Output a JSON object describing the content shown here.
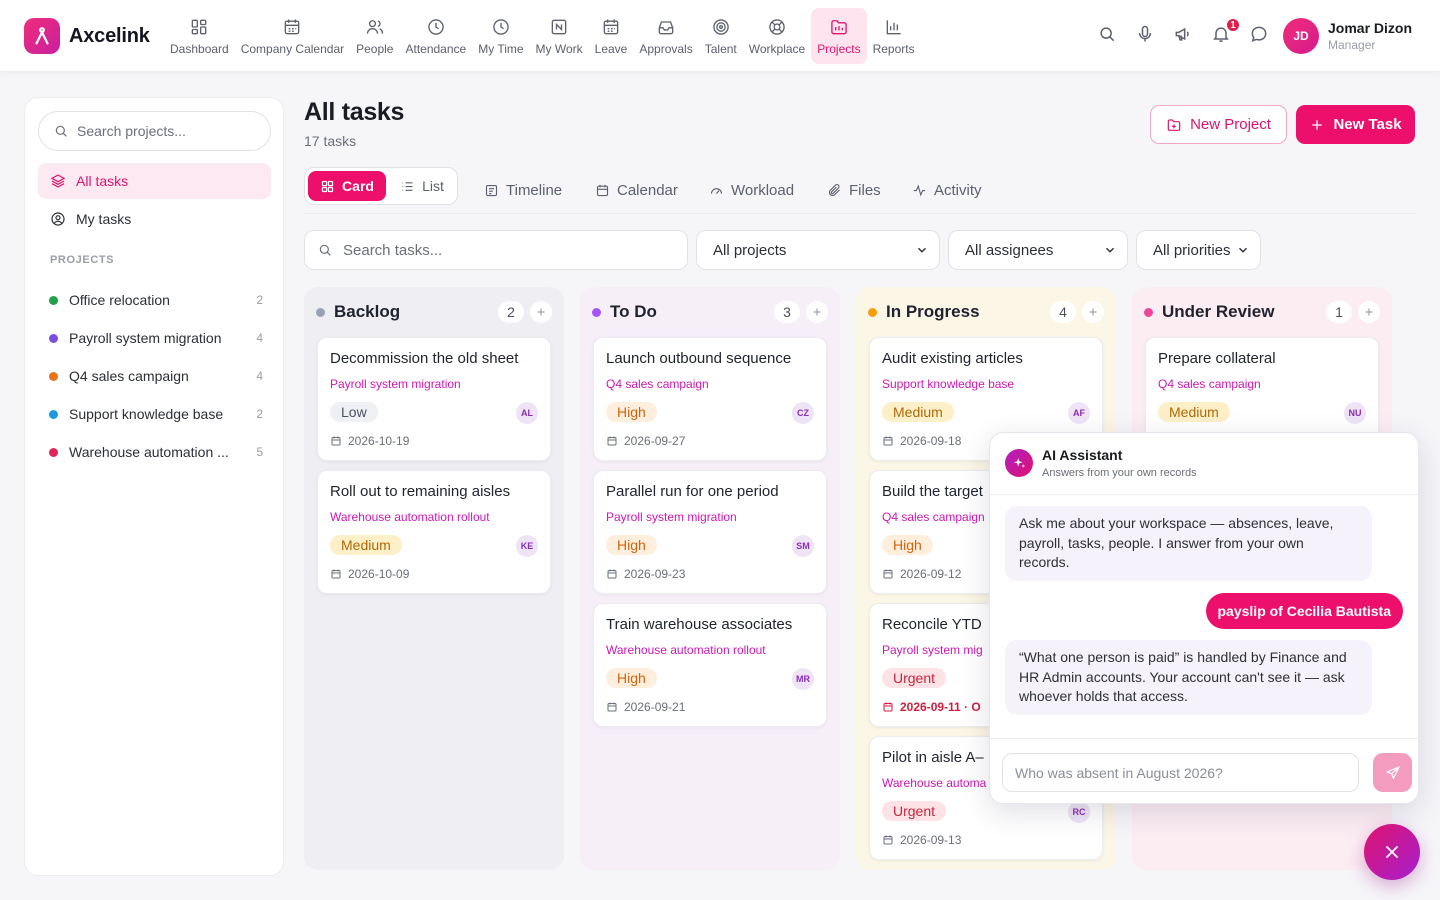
{
  "app": {
    "name": "Axcelink"
  },
  "nav": [
    {
      "label": "Dashboard",
      "icon": "dashboard-icon"
    },
    {
      "label": "Company Calendar",
      "icon": "calendar-icon"
    },
    {
      "label": "People",
      "icon": "people-icon"
    },
    {
      "label": "Attendance",
      "icon": "clock-icon"
    },
    {
      "label": "My Time",
      "icon": "clock-icon"
    },
    {
      "label": "My Work",
      "icon": "folder-icon"
    },
    {
      "label": "Leave",
      "icon": "calendar-icon"
    },
    {
      "label": "Approvals",
      "icon": "inbox-icon"
    },
    {
      "label": "Talent",
      "icon": "target-icon"
    },
    {
      "label": "Workplace",
      "icon": "lifebuoy-icon"
    },
    {
      "label": "Projects",
      "icon": "projects-icon",
      "active": true
    },
    {
      "label": "Reports",
      "icon": "bar-chart-icon"
    }
  ],
  "notifications": {
    "count": "1"
  },
  "user": {
    "initials": "JD",
    "name": "Jomar Dizon",
    "role": "Manager"
  },
  "sidebar": {
    "search_placeholder": "Search projects...",
    "links": [
      {
        "label": "All tasks",
        "active": true
      },
      {
        "label": "My tasks"
      }
    ],
    "projects_heading": "PROJECTS",
    "projects": [
      {
        "name": "Office relocation",
        "count": "2",
        "color": "#22a047"
      },
      {
        "name": "Payroll system migration",
        "count": "4",
        "color": "#7c4ddc"
      },
      {
        "name": "Q4 sales campaign",
        "count": "4",
        "color": "#e8731a"
      },
      {
        "name": "Support knowledge base",
        "count": "2",
        "color": "#1a9be0"
      },
      {
        "name": "Warehouse automation ...",
        "count": "5",
        "color": "#e0245e"
      }
    ]
  },
  "main": {
    "title": "All tasks",
    "subtitle": "17 tasks",
    "new_project": "New Project",
    "new_task": "New Task",
    "view_card": "Card",
    "view_list": "List",
    "tabs": [
      "Timeline",
      "Calendar",
      "Workload",
      "Files",
      "Activity"
    ],
    "search_placeholder": "Search tasks...",
    "filters": {
      "projects": "All projects",
      "assignees": "All assignees",
      "priorities": "All priorities"
    }
  },
  "board": {
    "columns": [
      {
        "title": "Backlog",
        "count": "2",
        "color": "#9aa3b5",
        "bg": "#eeeef3",
        "cards": [
          {
            "title": "Decommission the old sheet",
            "project": "Payroll system migration",
            "priority": "Low",
            "level": "low",
            "assignee": "AL",
            "date": "2026-10-19"
          },
          {
            "title": "Roll out to remaining aisles",
            "project": "Warehouse automation rollout",
            "priority": "Medium",
            "level": "medium",
            "assignee": "KE",
            "date": "2026-10-09"
          }
        ]
      },
      {
        "title": "To Do",
        "count": "3",
        "color": "#a855f7",
        "bg": "#f7eff8",
        "cards": [
          {
            "title": "Launch outbound sequence",
            "project": "Q4 sales campaign",
            "priority": "High",
            "level": "high",
            "assignee": "CZ",
            "date": "2026-09-27"
          },
          {
            "title": "Parallel run for one period",
            "project": "Payroll system migration",
            "priority": "High",
            "level": "high",
            "assignee": "SM",
            "date": "2026-09-23"
          },
          {
            "title": "Train warehouse associates",
            "project": "Warehouse automation rollout",
            "priority": "High",
            "level": "high",
            "assignee": "MR",
            "date": "2026-09-21"
          }
        ]
      },
      {
        "title": "In Progress",
        "count": "4",
        "color": "#f59e0b",
        "bg": "#fcf6e6",
        "cards": [
          {
            "title": "Audit existing articles",
            "project": "Support knowledge base",
            "priority": "Medium",
            "level": "medium",
            "assignee": "AF",
            "date": "2026-09-18"
          },
          {
            "title": "Build the target",
            "project": "Q4 sales campaign",
            "priority": "High",
            "level": "high",
            "assignee": "",
            "date": "2026-09-12"
          },
          {
            "title": "Reconcile YTD",
            "project": "Payroll system mig",
            "priority": "Urgent",
            "level": "urgent",
            "assignee": "",
            "date": "2026-09-11 · O",
            "overdue": true
          },
          {
            "title": "Pilot in aisle A–",
            "project": "Warehouse automa",
            "priority": "Urgent",
            "level": "urgent",
            "assignee": "RC",
            "date": "2026-09-13"
          }
        ]
      },
      {
        "title": "Under Review",
        "count": "1",
        "color": "#ec4899",
        "bg": "#fcedf3",
        "cards": [
          {
            "title": "Prepare collateral",
            "project": "Q4 sales campaign",
            "priority": "Medium",
            "level": "medium",
            "assignee": "NU",
            "date": ""
          }
        ]
      }
    ]
  },
  "assistant": {
    "title": "AI Assistant",
    "subtitle": "Answers from your own records",
    "greeting": "Ask me about your workspace — absences, leave, payroll, tasks, people. I answer from your own records.",
    "user_message": "payslip of Cecilia Bautista",
    "reply": "“What one person is paid” is handled by Finance and HR Admin accounts. Your account can't see it — ask whoever holds that access.",
    "input_placeholder": "Who was absent in August 2026?"
  }
}
